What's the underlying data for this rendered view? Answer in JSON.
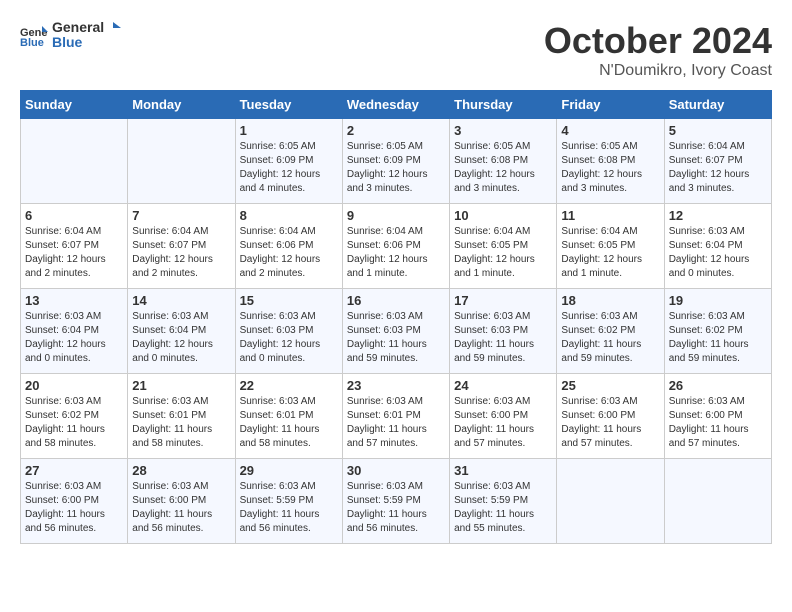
{
  "header": {
    "logo_general": "General",
    "logo_blue": "Blue",
    "month": "October 2024",
    "location": "N'Doumikro, Ivory Coast"
  },
  "days_of_week": [
    "Sunday",
    "Monday",
    "Tuesday",
    "Wednesday",
    "Thursday",
    "Friday",
    "Saturday"
  ],
  "weeks": [
    [
      {
        "day": "",
        "info": ""
      },
      {
        "day": "",
        "info": ""
      },
      {
        "day": "1",
        "info": "Sunrise: 6:05 AM\nSunset: 6:09 PM\nDaylight: 12 hours and 4 minutes."
      },
      {
        "day": "2",
        "info": "Sunrise: 6:05 AM\nSunset: 6:09 PM\nDaylight: 12 hours and 3 minutes."
      },
      {
        "day": "3",
        "info": "Sunrise: 6:05 AM\nSunset: 6:08 PM\nDaylight: 12 hours and 3 minutes."
      },
      {
        "day": "4",
        "info": "Sunrise: 6:05 AM\nSunset: 6:08 PM\nDaylight: 12 hours and 3 minutes."
      },
      {
        "day": "5",
        "info": "Sunrise: 6:04 AM\nSunset: 6:07 PM\nDaylight: 12 hours and 3 minutes."
      }
    ],
    [
      {
        "day": "6",
        "info": "Sunrise: 6:04 AM\nSunset: 6:07 PM\nDaylight: 12 hours and 2 minutes."
      },
      {
        "day": "7",
        "info": "Sunrise: 6:04 AM\nSunset: 6:07 PM\nDaylight: 12 hours and 2 minutes."
      },
      {
        "day": "8",
        "info": "Sunrise: 6:04 AM\nSunset: 6:06 PM\nDaylight: 12 hours and 2 minutes."
      },
      {
        "day": "9",
        "info": "Sunrise: 6:04 AM\nSunset: 6:06 PM\nDaylight: 12 hours and 1 minute."
      },
      {
        "day": "10",
        "info": "Sunrise: 6:04 AM\nSunset: 6:05 PM\nDaylight: 12 hours and 1 minute."
      },
      {
        "day": "11",
        "info": "Sunrise: 6:04 AM\nSunset: 6:05 PM\nDaylight: 12 hours and 1 minute."
      },
      {
        "day": "12",
        "info": "Sunrise: 6:03 AM\nSunset: 6:04 PM\nDaylight: 12 hours and 0 minutes."
      }
    ],
    [
      {
        "day": "13",
        "info": "Sunrise: 6:03 AM\nSunset: 6:04 PM\nDaylight: 12 hours and 0 minutes."
      },
      {
        "day": "14",
        "info": "Sunrise: 6:03 AM\nSunset: 6:04 PM\nDaylight: 12 hours and 0 minutes."
      },
      {
        "day": "15",
        "info": "Sunrise: 6:03 AM\nSunset: 6:03 PM\nDaylight: 12 hours and 0 minutes."
      },
      {
        "day": "16",
        "info": "Sunrise: 6:03 AM\nSunset: 6:03 PM\nDaylight: 11 hours and 59 minutes."
      },
      {
        "day": "17",
        "info": "Sunrise: 6:03 AM\nSunset: 6:03 PM\nDaylight: 11 hours and 59 minutes."
      },
      {
        "day": "18",
        "info": "Sunrise: 6:03 AM\nSunset: 6:02 PM\nDaylight: 11 hours and 59 minutes."
      },
      {
        "day": "19",
        "info": "Sunrise: 6:03 AM\nSunset: 6:02 PM\nDaylight: 11 hours and 59 minutes."
      }
    ],
    [
      {
        "day": "20",
        "info": "Sunrise: 6:03 AM\nSunset: 6:02 PM\nDaylight: 11 hours and 58 minutes."
      },
      {
        "day": "21",
        "info": "Sunrise: 6:03 AM\nSunset: 6:01 PM\nDaylight: 11 hours and 58 minutes."
      },
      {
        "day": "22",
        "info": "Sunrise: 6:03 AM\nSunset: 6:01 PM\nDaylight: 11 hours and 58 minutes."
      },
      {
        "day": "23",
        "info": "Sunrise: 6:03 AM\nSunset: 6:01 PM\nDaylight: 11 hours and 57 minutes."
      },
      {
        "day": "24",
        "info": "Sunrise: 6:03 AM\nSunset: 6:00 PM\nDaylight: 11 hours and 57 minutes."
      },
      {
        "day": "25",
        "info": "Sunrise: 6:03 AM\nSunset: 6:00 PM\nDaylight: 11 hours and 57 minutes."
      },
      {
        "day": "26",
        "info": "Sunrise: 6:03 AM\nSunset: 6:00 PM\nDaylight: 11 hours and 57 minutes."
      }
    ],
    [
      {
        "day": "27",
        "info": "Sunrise: 6:03 AM\nSunset: 6:00 PM\nDaylight: 11 hours and 56 minutes."
      },
      {
        "day": "28",
        "info": "Sunrise: 6:03 AM\nSunset: 6:00 PM\nDaylight: 11 hours and 56 minutes."
      },
      {
        "day": "29",
        "info": "Sunrise: 6:03 AM\nSunset: 5:59 PM\nDaylight: 11 hours and 56 minutes."
      },
      {
        "day": "30",
        "info": "Sunrise: 6:03 AM\nSunset: 5:59 PM\nDaylight: 11 hours and 56 minutes."
      },
      {
        "day": "31",
        "info": "Sunrise: 6:03 AM\nSunset: 5:59 PM\nDaylight: 11 hours and 55 minutes."
      },
      {
        "day": "",
        "info": ""
      },
      {
        "day": "",
        "info": ""
      }
    ]
  ]
}
